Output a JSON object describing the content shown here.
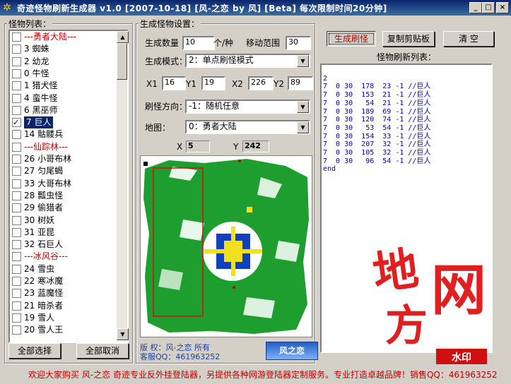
{
  "window": {
    "title": "奇迹怪物刷新生成器 v1.0   [2007-10-18]  [风-之恋 by 风]  [Beta]   每次限制时间20分钟]",
    "minimize": "_",
    "maximize": "□",
    "close": "×"
  },
  "monster_list": {
    "label": "怪物列表：",
    "items": [
      {
        "text": "---勇者大陆---",
        "separator": true,
        "checked": false
      },
      {
        "text": "3 蜘蛛",
        "checked": false
      },
      {
        "text": "2 幼龙",
        "checked": false
      },
      {
        "text": "0 牛怪",
        "checked": false
      },
      {
        "text": "1 猎犬怪",
        "checked": false
      },
      {
        "text": "4 蛮牛怪",
        "checked": false
      },
      {
        "text": "6 黑巫师",
        "checked": false
      },
      {
        "text": "7 巨人",
        "checked": true,
        "selected": true
      },
      {
        "text": "14 骷髅兵",
        "checked": false
      },
      {
        "text": "---仙踪林---",
        "separator": true,
        "checked": false
      },
      {
        "text": "26 小哥布林",
        "checked": false
      },
      {
        "text": "27 匀尾蝎",
        "checked": false
      },
      {
        "text": "33 大哥布林",
        "checked": false
      },
      {
        "text": "28 瓢虫怪",
        "checked": false
      },
      {
        "text": "29 偷猎者",
        "checked": false
      },
      {
        "text": "30 树妖",
        "checked": false
      },
      {
        "text": "31 亚昆",
        "checked": false
      },
      {
        "text": "32 石巨人",
        "checked": false
      },
      {
        "text": "---冰风谷---",
        "separator": true,
        "checked": false
      },
      {
        "text": "24 雪虫",
        "checked": false
      },
      {
        "text": "22 寒冰魔",
        "checked": false
      },
      {
        "text": "23 蓝魔怪",
        "checked": false
      },
      {
        "text": "21 暗杀者",
        "checked": false
      },
      {
        "text": "19 雪人",
        "checked": false
      },
      {
        "text": "20 雪人王",
        "checked": false
      }
    ],
    "select_all": "全部选择",
    "cancel_all": "全部取消"
  },
  "settings": {
    "label": "生成怪物设置：",
    "count_label": "生成数量",
    "count_value": "10",
    "count_unit": "个/种",
    "move_label": "移动范围",
    "move_value": "30",
    "mode_label": "生成模式：",
    "mode_value": "2：单点刷怪模式",
    "x1_label": "X1",
    "x1_value": "16",
    "y1_label": "Y1",
    "y1_value": "19",
    "x2_label": "X2",
    "x2_value": "226",
    "y2_label": "Y2",
    "y2_value": "89",
    "direction_label": "刷怪方向：",
    "direction_value": "-1：随机任意",
    "map_label": "地图：",
    "map_value": "0：勇者大陆",
    "x_readout_label": "X",
    "x_readout": "5",
    "y_readout_label": "Y",
    "y_readout": "242"
  },
  "info": {
    "copyright": "版  权：风-之恋 所有",
    "qq": "客服QQ：461963252",
    "logo": "风之恋"
  },
  "actions": {
    "generate": "生成刷怪",
    "copy": "复制剪贴板",
    "clear": "清  空"
  },
  "output": {
    "label": "怪物刷新列表：",
    "lines": [
      "",
      "2",
      "7  0 30  178  23 -1 //巨人",
      "7  0 30  153  21 -1 //巨人",
      "7  0 30   54  21 -1 //巨人",
      "7  0 30  189  69 -1 //巨人",
      "7  0 30  120  74 -1 //巨人",
      "7  0 30   53  54 -1 //巨人",
      "7  0 30  154  33 -1 //巨人",
      "7  0 30  207  32 -1 //巨人",
      "7  0 30  105  32 -1 //巨人",
      "7  0 30   96  54 -1 //巨人",
      "end"
    ]
  },
  "status": {
    "text": "欢迎大家购买 风-之恋 奇迹专业反外挂登陆器，另提供各种网游登陆器定制服务。专业打造卓越品牌！销售QQ：461963252"
  },
  "watermark": {
    "c1": "地",
    "c2": "网",
    "c3": "方",
    "box": "水印"
  },
  "colors": {
    "title_bar": "#0a246a",
    "face": "#d4d0c8",
    "output_text": "#0000a0",
    "separator": "#c00000",
    "map_green": "#1e9e2e"
  }
}
